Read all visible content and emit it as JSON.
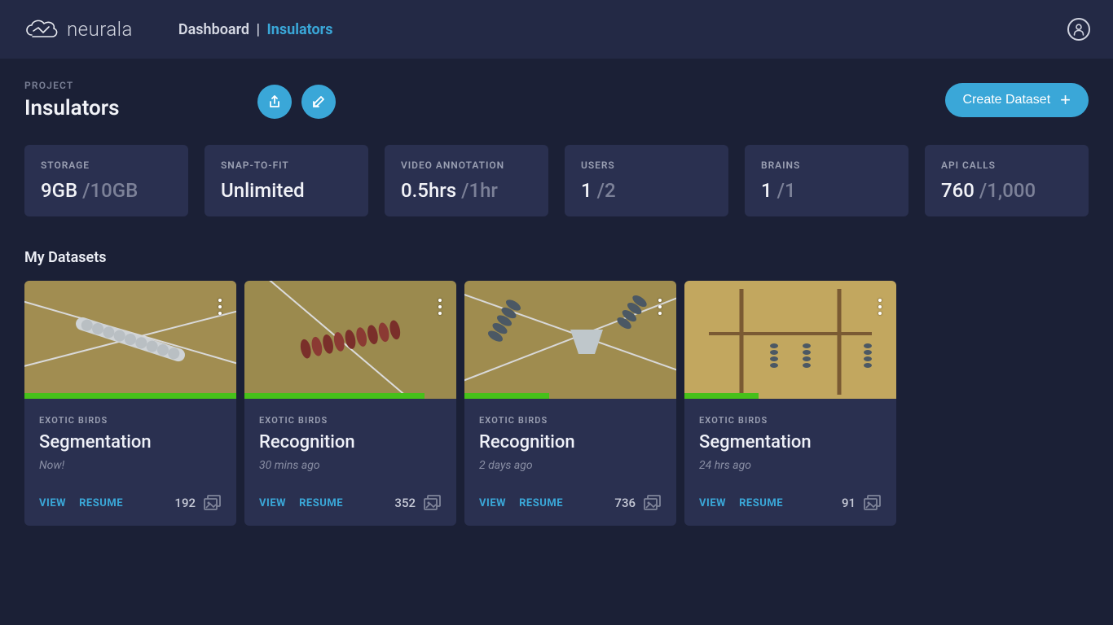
{
  "brand": "neurala",
  "breadcrumb": {
    "dashboard": "Dashboard",
    "separator": "|",
    "current": "Insulators"
  },
  "project": {
    "label": "PROJECT",
    "name": "Insulators"
  },
  "create_button": "Create Dataset",
  "stats": [
    {
      "label": "STORAGE",
      "value": "9GB ",
      "muted": "/10GB"
    },
    {
      "label": "SNAP-TO-FIT",
      "value": "Unlimited",
      "muted": ""
    },
    {
      "label": "VIDEO ANNOTATION",
      "value": "0.5hrs ",
      "muted": "/1hr"
    },
    {
      "label": "USERS",
      "value": "1 ",
      "muted": "/2"
    },
    {
      "label": "BRAINS",
      "value": "1 ",
      "muted": "/1"
    },
    {
      "label": "API CALLS",
      "value": "760 ",
      "muted": "/1,000"
    }
  ],
  "datasets_section": "My Datasets",
  "card_actions": {
    "view": "VIEW",
    "resume": "RESUME"
  },
  "datasets": [
    {
      "category": "EXOTIC BIRDS",
      "title": "Segmentation",
      "time": "Now!",
      "count": "192",
      "progress": 100
    },
    {
      "category": "EXOTIC BIRDS",
      "title": "Recognition",
      "time": "30 mins ago",
      "count": "352",
      "progress": 85
    },
    {
      "category": "EXOTIC BIRDS",
      "title": "Recognition",
      "time": "2 days ago",
      "count": "736",
      "progress": 40
    },
    {
      "category": "EXOTIC BIRDS",
      "title": "Segmentation",
      "time": "24 hrs ago",
      "count": "91",
      "progress": 35
    }
  ]
}
